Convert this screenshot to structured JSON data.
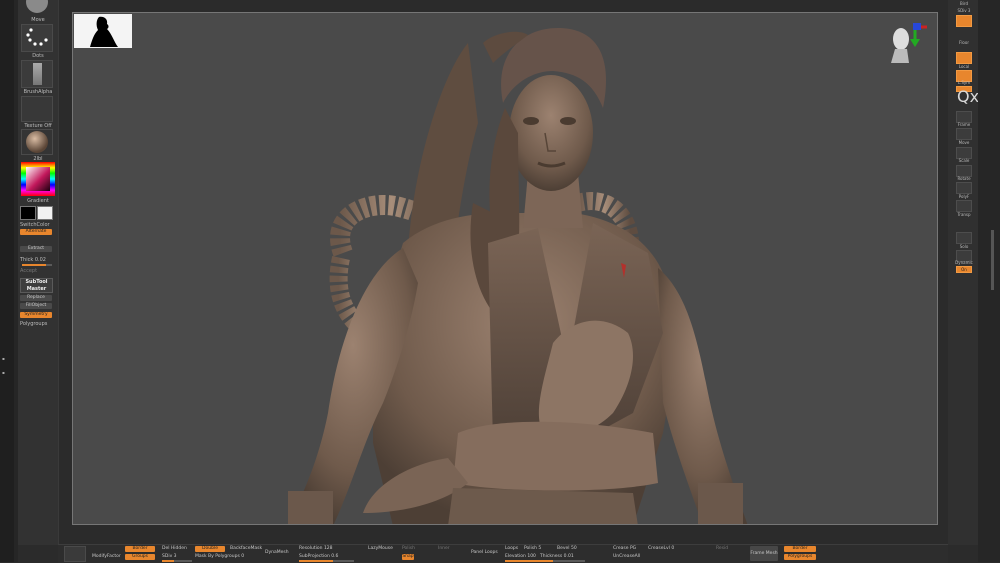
{
  "left_shelf": {
    "brush_label": "Move",
    "stroke_label": "Dots",
    "alpha_label": "BrushAlpha",
    "texture_label": "Texture Off",
    "material_label": "2lbl",
    "gradient_label": "Gradient",
    "switch_color_label": "SwitchColor",
    "alternate_label": "Alternate",
    "extract_label": "Extract",
    "thick_label": "Thick 0.02",
    "accept_label": "Accept",
    "subtool_master_label": "SubTool Master",
    "replace_label": "Replace",
    "fill_object_label": "FillObject",
    "symmetry_label": "Symmetry",
    "polygroups_label": "Polygroups"
  },
  "right_shelf": {
    "top_label": "Bird",
    "sdiv_label": "SDiv 3",
    "floor_label": "Floor",
    "local_label": "Local",
    "lsym_label": "L.Sym",
    "xyz_label": "Qxyz",
    "frame_label": "Frame",
    "move_label": "Move",
    "scale_label": "Scale",
    "rotate_label": "Rotate",
    "polyf_label": "PolyF",
    "transp_label": "Transp",
    "solo_label": "Solo",
    "dynamic_label": "Dynamic",
    "on_label": "On"
  },
  "bottom_bar": {
    "border": "Border",
    "groups": "Groups",
    "modify_factor": "ModifyFactor",
    "del_hidden": "Del Hidden",
    "sdiv": "SDiv 3",
    "double": "Double",
    "mask_by_polygroups": "Mask By Polygroups 0",
    "backface_mask": "BackfaceMask",
    "dynamesh": "DynaMesh",
    "resolution": "Resolution 128",
    "subprojection": "SubProjection 0.6",
    "lazymouse": "LazyMouse",
    "lazy_b": "Polish",
    "lazy_c": "Snap",
    "clip": "Inner",
    "panel_loops": "Panel Loops",
    "loops": "Loops",
    "polish": "Polish 5",
    "bevel": "Bevel 50",
    "elevation": "Elevation 100",
    "thickness": "Thickness 0.01",
    "crease_pg": "Crease PG",
    "uncrease_all": "UnCreaseAll",
    "crease_lvl": "CreaseLvl 0",
    "frame_mesh": "Frame Mesh",
    "border2": "Border",
    "polygroups": "Polygroups",
    "resid": "Resid"
  }
}
